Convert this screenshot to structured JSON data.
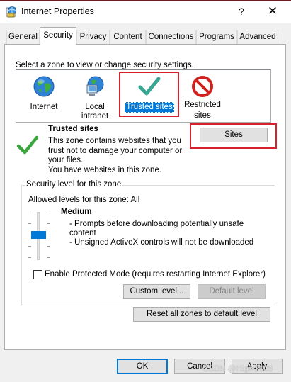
{
  "window": {
    "title": "Internet Properties",
    "help_glyph": "?",
    "close_glyph": "✕"
  },
  "tabs": [
    {
      "label": "General"
    },
    {
      "label": "Security"
    },
    {
      "label": "Privacy"
    },
    {
      "label": "Content"
    },
    {
      "label": "Connections"
    },
    {
      "label": "Programs"
    },
    {
      "label": "Advanced"
    }
  ],
  "security": {
    "instruction": "Select a zone to view or change security settings.",
    "zones": [
      {
        "label": "Internet",
        "icon": "globe-icon"
      },
      {
        "label": "Local intranet",
        "icon": "local-intranet-icon"
      },
      {
        "label": "Trusted sites",
        "icon": "green-checkmark-icon",
        "selected": true
      },
      {
        "label_line1": "Restricted",
        "label_line2": "sites",
        "icon": "restricted-icon"
      }
    ],
    "zone_info": {
      "title": "Trusted sites",
      "desc_lines": [
        "This zone contains websites that you",
        "trust not to damage your computer or",
        "your files.",
        "You have websites in this zone."
      ]
    },
    "sites_button": "Sites",
    "level_group": {
      "caption": "Security level for this zone",
      "allowed": "Allowed levels for this zone: All",
      "level_name": "Medium",
      "bullets": [
        "- Prompts before downloading potentially unsafe",
        "content",
        "- Unsigned ActiveX controls will not be downloaded"
      ],
      "slider_level": "Medium"
    },
    "protected_mode": {
      "label": "Enable Protected Mode (requires restarting Internet Explorer)",
      "checked": false
    },
    "custom_level_button": "Custom level...",
    "default_level_button": "Default level",
    "reset_all_button": "Reset all zones to default level"
  },
  "footer": {
    "ok": "OK",
    "cancel": "Cancel",
    "apply": "Apply",
    "watermark": "CSDN @Higel2008"
  },
  "colors": {
    "selection": "#0078d7",
    "highlight_box": "#d6202b",
    "check_green": "#3aa53a"
  }
}
